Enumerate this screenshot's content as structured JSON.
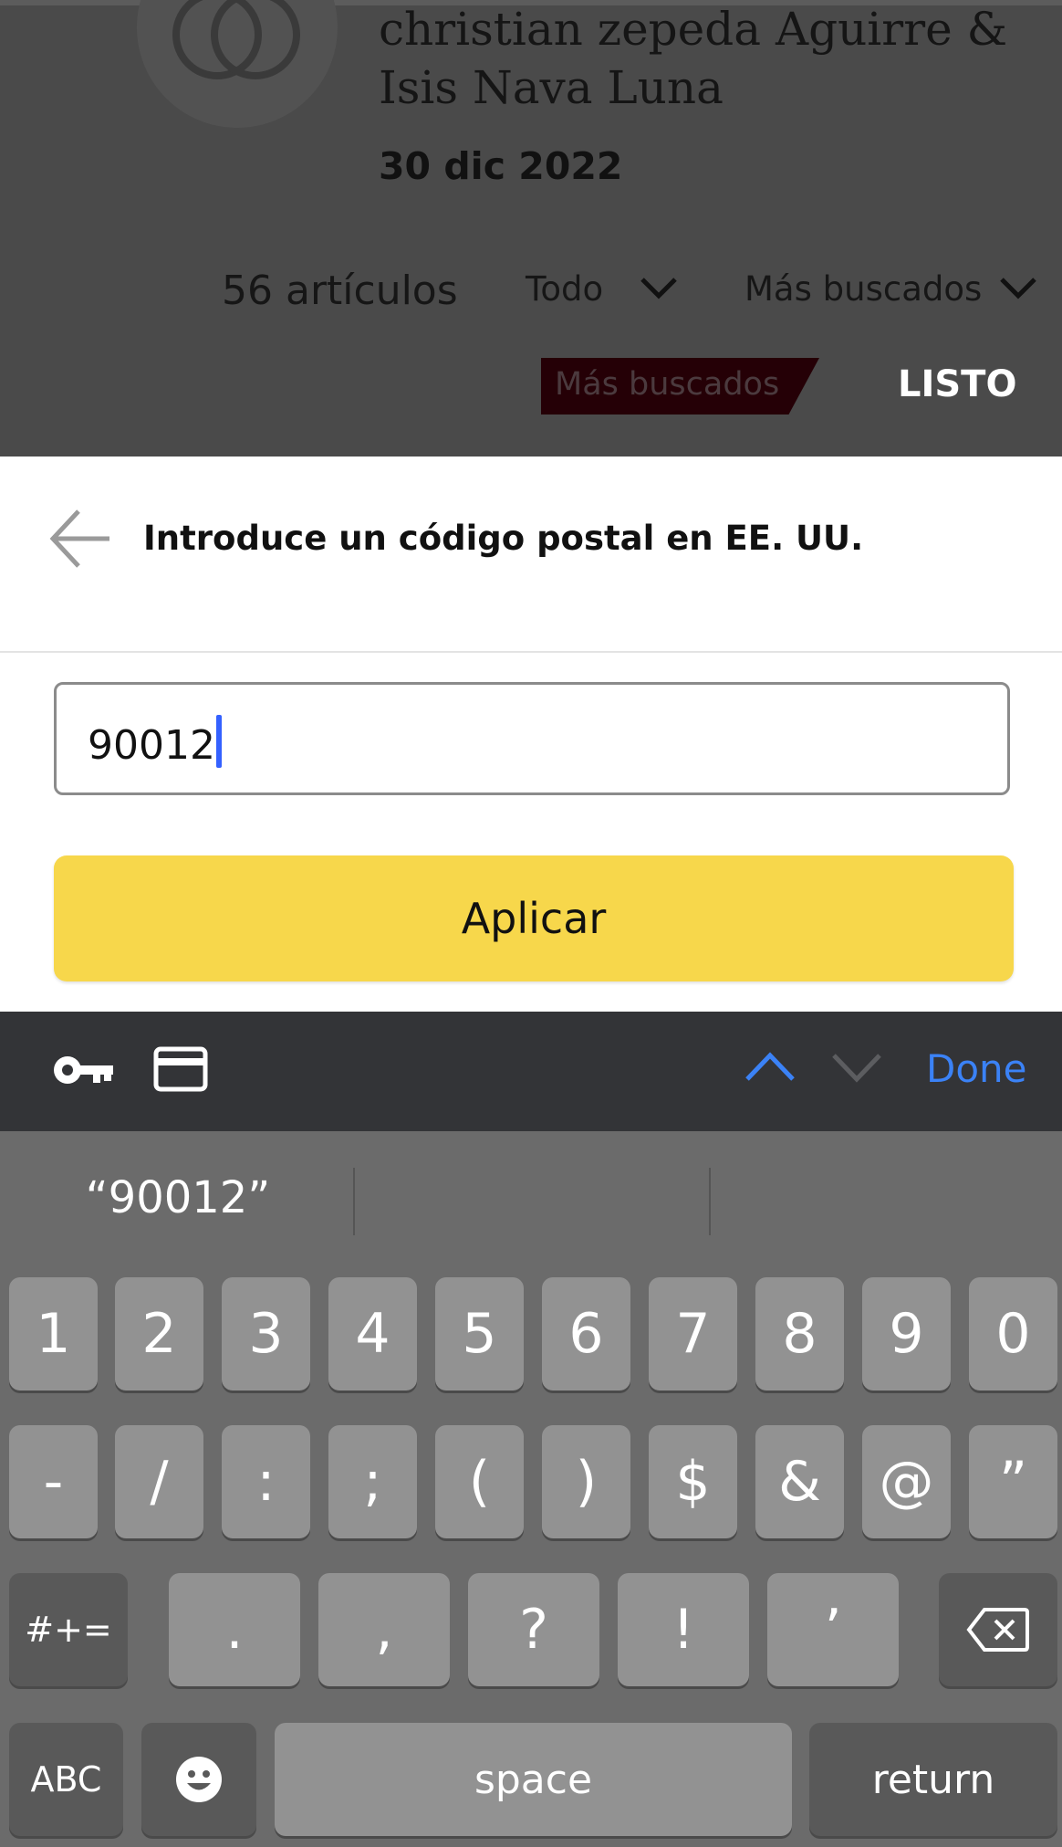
{
  "background_page": {
    "registry_names": "christian zepeda Aguirre & Isis Nava Luna",
    "registry_date": "30 dic 2022",
    "item_count": "56 artículos",
    "filter_label": "Todo",
    "sort_label": "Más buscados",
    "most_wanted_tag": "Más buscados",
    "done_label": "LISTO"
  },
  "sheet": {
    "title": "Introduce un código postal en EE. UU.",
    "zip_value": "90012",
    "apply_label": "Aplicar"
  },
  "accessory_bar": {
    "done_label": "Done"
  },
  "keyboard": {
    "suggestion": "“90012”",
    "row1": [
      "1",
      "2",
      "3",
      "4",
      "5",
      "6",
      "7",
      "8",
      "9",
      "0"
    ],
    "row2": [
      "-",
      "/",
      ":",
      ";",
      "(",
      ")",
      "$",
      "&",
      "@",
      "”"
    ],
    "row3": [
      ".",
      ",",
      "?",
      "!",
      "’"
    ],
    "shift_label": "#+=",
    "abc_label": "ABC",
    "space_label": "space",
    "return_label": "return"
  },
  "icons": [
    "rings-icon",
    "chevron-down-icon",
    "back-arrow-icon",
    "key-icon",
    "credit-card-icon",
    "chevron-up-icon",
    "delete-icon",
    "emoji-icon"
  ]
}
